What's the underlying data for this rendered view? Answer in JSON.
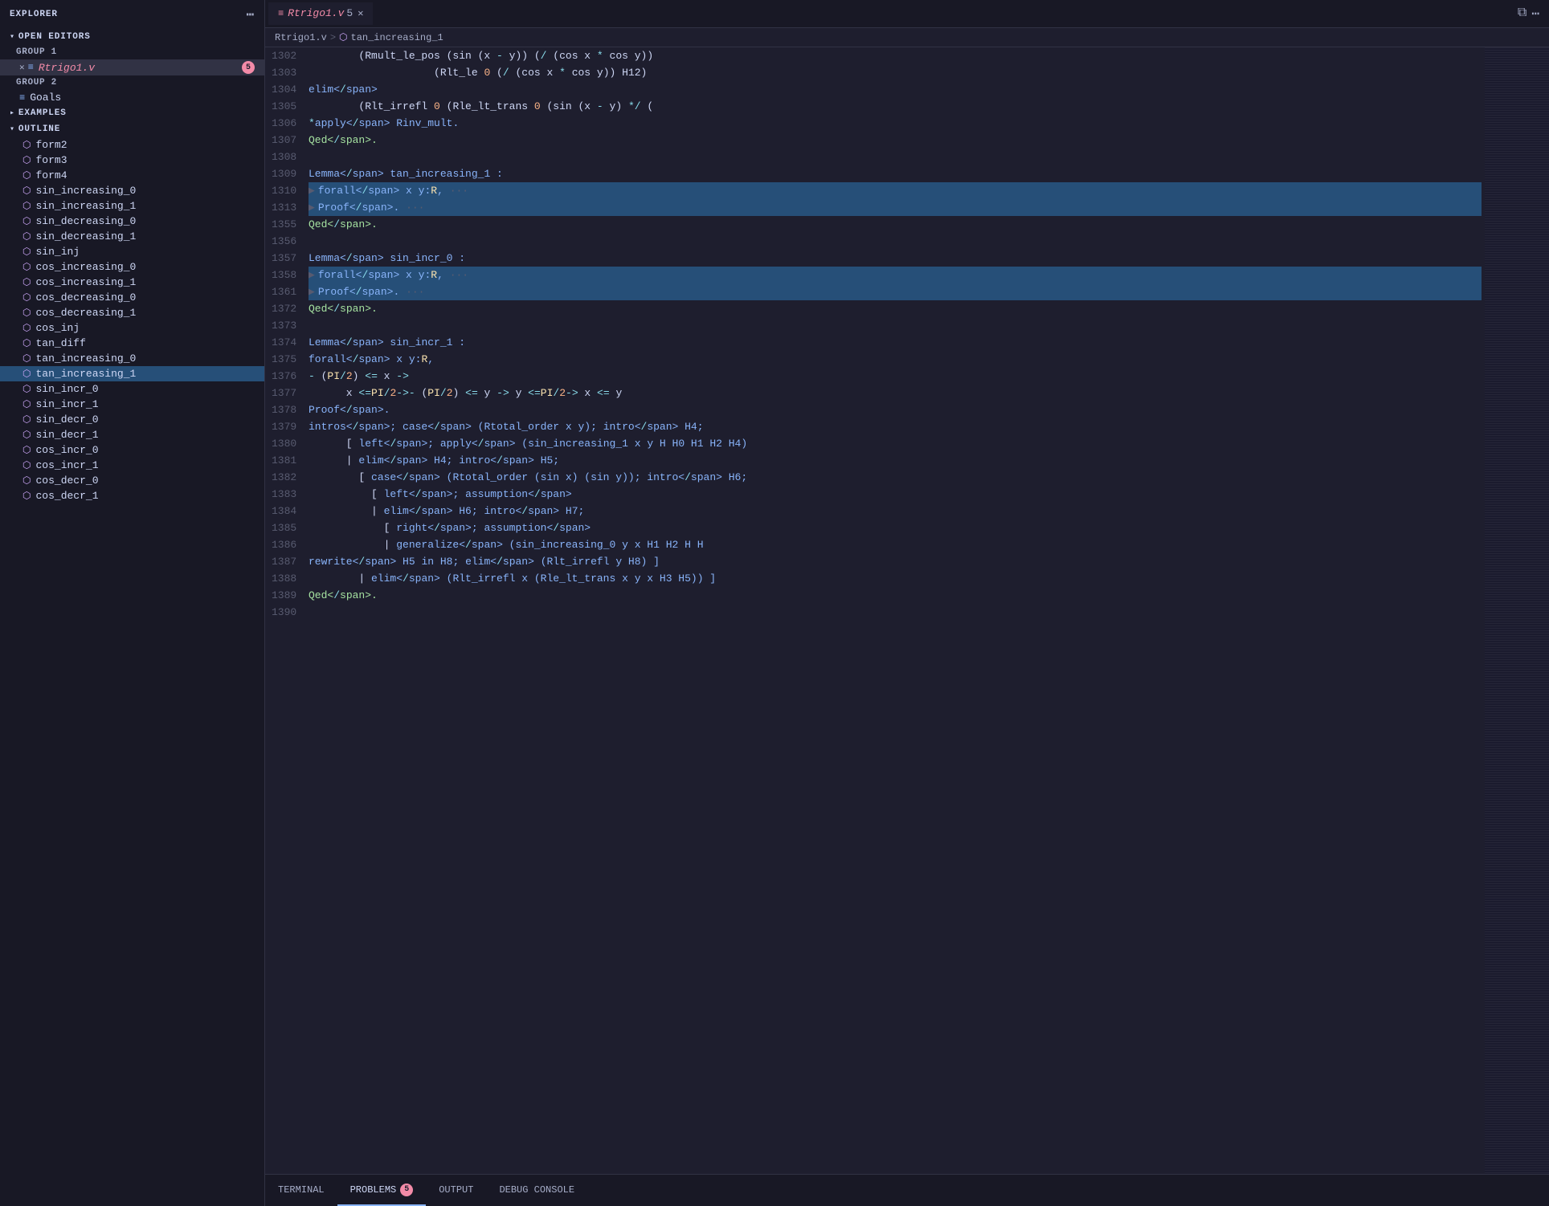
{
  "sidebar": {
    "title": "EXPLORER",
    "more_icon": "⋯",
    "sections": {
      "open_editors": {
        "label": "OPEN EDITORS",
        "expanded": true,
        "groups": [
          {
            "label": "GROUP 1",
            "files": [
              {
                "name": "Rtrigo1.v",
                "badge": "5",
                "active": true
              }
            ]
          },
          {
            "label": "GROUP 2",
            "files": [
              {
                "name": "Goals",
                "icon": "≡"
              }
            ]
          }
        ]
      },
      "examples": {
        "label": "EXAMPLES",
        "expanded": false
      },
      "outline": {
        "label": "OUTLINE",
        "expanded": true,
        "items": [
          "form2",
          "form3",
          "form4",
          "sin_increasing_0",
          "sin_increasing_1",
          "sin_decreasing_0",
          "sin_decreasing_1",
          "sin_inj",
          "cos_increasing_0",
          "cos_increasing_1",
          "cos_decreasing_0",
          "cos_decreasing_1",
          "cos_inj",
          "tan_diff",
          "tan_increasing_0",
          "tan_increasing_1",
          "sin_incr_0",
          "sin_incr_1",
          "sin_decr_0",
          "sin_decr_1",
          "cos_incr_0",
          "cos_incr_1",
          "cos_decr_0",
          "cos_decr_1"
        ]
      }
    }
  },
  "editor": {
    "tab_title": "Rtrigo1.v",
    "tab_version": "5",
    "breadcrumb": [
      "Rtrigo1.v",
      "tan_increasing_1"
    ],
    "lines": [
      {
        "num": "1302",
        "text": "        (Rmult_le_pos (sin (x - y)) (/ (cos x * cos y))",
        "highlight": false
      },
      {
        "num": "1303",
        "text": "                    (Rlt_le 0 (/ (cos x * cos y)) H12)",
        "highlight": false
      },
      {
        "num": "1304",
        "text": "      elim",
        "highlight": false
      },
      {
        "num": "1305",
        "text": "        (Rlt_irrefl 0 (Rle_lt_trans 0 (sin (x - y) * / (",
        "highlight": false
      },
      {
        "num": "1306",
        "text": "    * apply Rinv_mult.",
        "highlight": false
      },
      {
        "num": "1307",
        "text": "  Qed.",
        "highlight": false
      },
      {
        "num": "1308",
        "text": "",
        "highlight": false
      },
      {
        "num": "1309",
        "text": "  Lemma tan_increasing_1 :",
        "highlight": false
      },
      {
        "num": "1310",
        "text": "    forall x y:R, ···",
        "highlight": true,
        "folded": true
      },
      {
        "num": "1313",
        "text": "  Proof. ···",
        "highlight": true,
        "folded": true
      },
      {
        "num": "1355",
        "text": "  Qed.",
        "highlight": false
      },
      {
        "num": "1356",
        "text": "",
        "highlight": false
      },
      {
        "num": "1357",
        "text": "  Lemma sin_incr_0 :",
        "highlight": false
      },
      {
        "num": "1358",
        "text": "    forall x y:R, ···",
        "highlight": true,
        "folded": true
      },
      {
        "num": "1361",
        "text": "  Proof. ···",
        "highlight": true,
        "folded": true
      },
      {
        "num": "1372",
        "text": "  Qed.",
        "highlight": false
      },
      {
        "num": "1373",
        "text": "",
        "highlight": false
      },
      {
        "num": "1374",
        "text": "  Lemma sin_incr_1 :",
        "highlight": false
      },
      {
        "num": "1375",
        "text": "    forall x y:R,",
        "highlight": false
      },
      {
        "num": "1376",
        "text": "      - (PI / 2) <= x ->",
        "highlight": false
      },
      {
        "num": "1377",
        "text": "      x <= PI / 2 -> - (PI / 2) <= y -> y <= PI / 2 -> x <= y",
        "highlight": false
      },
      {
        "num": "1378",
        "text": "  Proof.",
        "highlight": false
      },
      {
        "num": "1379",
        "text": "    intros; case (Rtotal_order x y); intro H4;",
        "highlight": false
      },
      {
        "num": "1380",
        "text": "      [ left; apply (sin_increasing_1 x y H H0 H1 H2 H4)",
        "highlight": false
      },
      {
        "num": "1381",
        "text": "      | elim H4; intro H5;",
        "highlight": false
      },
      {
        "num": "1382",
        "text": "        [ case (Rtotal_order (sin x) (sin y)); intro H6;",
        "highlight": false
      },
      {
        "num": "1383",
        "text": "          [ left; assumption",
        "highlight": false
      },
      {
        "num": "1384",
        "text": "          | elim H6; intro H7;",
        "highlight": false
      },
      {
        "num": "1385",
        "text": "            [ right; assumption",
        "highlight": false
      },
      {
        "num": "1386",
        "text": "            | generalize (sin_increasing_0 y x H1 H2 H H",
        "highlight": false
      },
      {
        "num": "1387",
        "text": "              rewrite H5 in H8; elim (Rlt_irrefl y H8) ]",
        "highlight": false
      },
      {
        "num": "1388",
        "text": "        | elim (Rlt_irrefl x (Rle_lt_trans x y x H3 H5)) ]",
        "highlight": false
      },
      {
        "num": "1389",
        "text": "  Qed.",
        "highlight": false
      },
      {
        "num": "1390",
        "text": "",
        "highlight": false
      }
    ]
  },
  "bottom_panel": {
    "tabs": [
      {
        "label": "TERMINAL",
        "active": false
      },
      {
        "label": "PROBLEMS",
        "active": true,
        "badge": "5"
      },
      {
        "label": "OUTPUT",
        "active": false
      },
      {
        "label": "DEBUG CONSOLE",
        "active": false
      }
    ]
  }
}
